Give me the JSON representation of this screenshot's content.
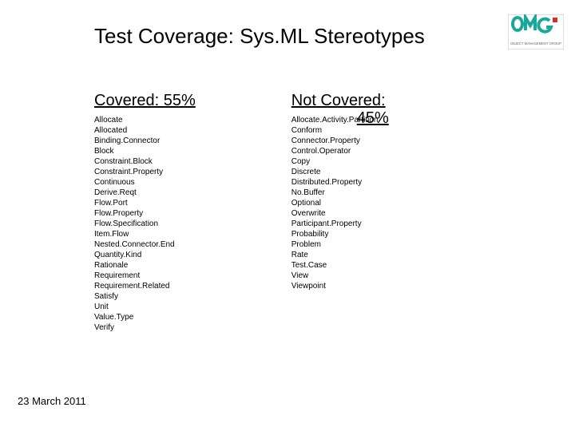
{
  "title": "Test Coverage: Sys.ML Stereotypes",
  "covered": {
    "heading": "Covered: 55%",
    "items": [
      "Allocate",
      "Allocated",
      "Binding.Connector",
      "Block",
      "Constraint.Block",
      "Constraint.Property",
      "Continuous",
      "Derive.Reqt",
      "Flow.Port",
      "Flow.Property",
      "Flow.Specification",
      "Item.Flow",
      "Nested.Connector.End",
      "Quantity.Kind",
      "Rationale",
      "Requirement",
      "Requirement.Related",
      "Satisfy",
      "Unit",
      "Value.Type",
      "Verify"
    ]
  },
  "notCovered": {
    "headingLine1": "Not Covered:",
    "headingLine2": "45%",
    "items": [
      "Allocate.Activity.Partition",
      "Conform",
      "Connector.Property",
      "Control.Operator",
      "Copy",
      "Discrete",
      "Distributed.Property",
      "No.Buffer",
      "Optional",
      "Overwrite",
      "Participant.Property",
      "Probability",
      "Problem",
      "Rate",
      "Test.Case",
      "View",
      "Viewpoint"
    ]
  },
  "date": "23 March 2011",
  "logo": {
    "name": "omg-logo"
  }
}
